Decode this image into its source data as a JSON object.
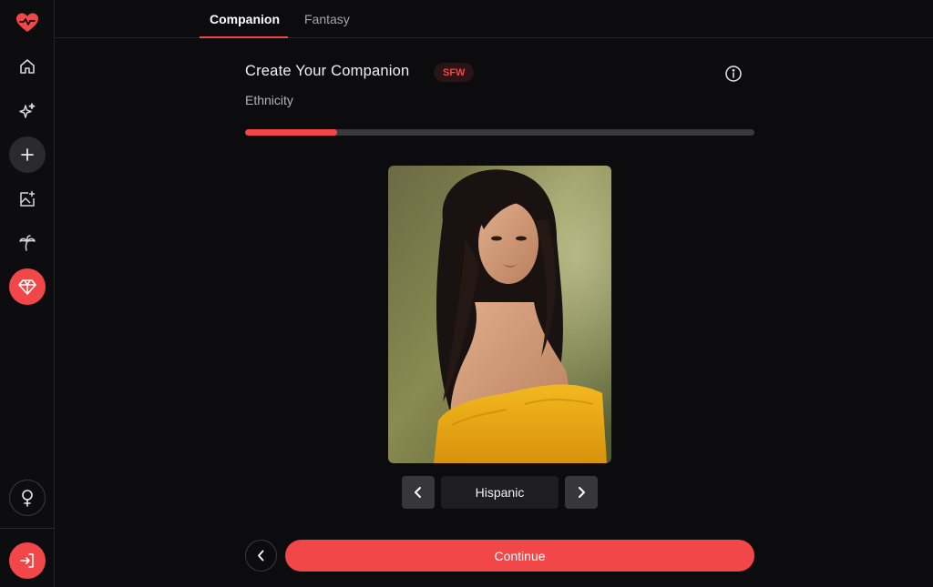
{
  "sidebar": {
    "items": [
      {
        "icon": "heart-pulse-logo-icon"
      },
      {
        "icon": "home-icon"
      },
      {
        "icon": "sparkles-icon"
      },
      {
        "icon": "plus-icon"
      },
      {
        "icon": "image-add-icon"
      },
      {
        "icon": "palm-tree-icon"
      },
      {
        "icon": "diamond-icon"
      },
      {
        "icon": "female-symbol-icon"
      },
      {
        "icon": "login-icon"
      }
    ]
  },
  "tabs": [
    {
      "label": "Companion",
      "active": true
    },
    {
      "label": "Fantasy",
      "active": false
    }
  ],
  "header": {
    "title": "Create Your Companion",
    "badge": "SFW",
    "step_label": "Ethnicity"
  },
  "progress": {
    "fraction": 0.18
  },
  "selector": {
    "value": "Hispanic"
  },
  "actions": {
    "continue_label": "Continue"
  },
  "colors": {
    "accent": "#f24749",
    "background": "#0c0b0d"
  }
}
